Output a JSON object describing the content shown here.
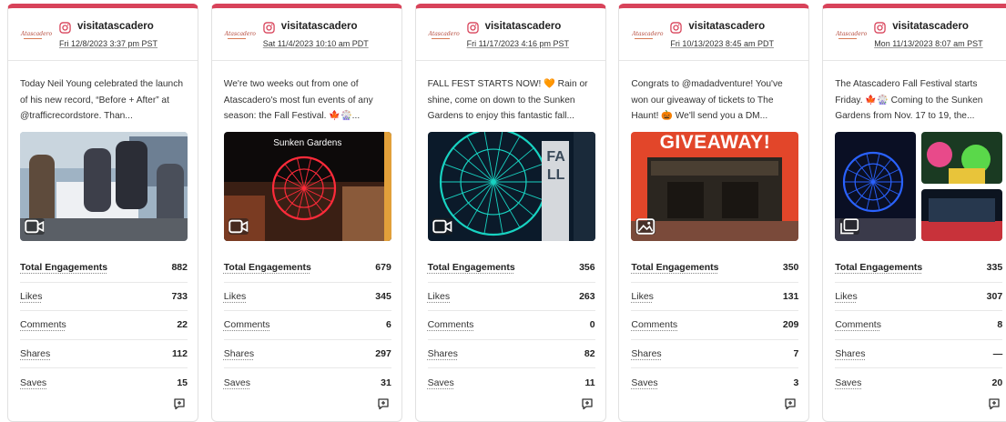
{
  "colors": {
    "accent": "#d8435a",
    "instagram": "#d8435a"
  },
  "icons": {
    "platform": "instagram-icon",
    "video": "video-icon",
    "image": "image-icon",
    "gallery": "gallery-icon",
    "comment": "add-comment-icon"
  },
  "metric_labels": [
    "Total Engagements",
    "Likes",
    "Comments",
    "Shares",
    "Saves"
  ],
  "posts": [
    {
      "logo": "Atascadero",
      "account": "visitatascadero",
      "date": "Fri 12/8/2023 3:37 pm PST",
      "caption": "Today Neil Young celebrated the launch of his new record, “Before + After” at @trafficrecordstore. Than...",
      "media_type": "video",
      "media_text": "",
      "metrics": [
        "882",
        "733",
        "22",
        "112",
        "15"
      ]
    },
    {
      "logo": "Atascadero",
      "account": "visitatascadero",
      "date": "Sat 11/4/2023 10:10 am PDT",
      "caption": "We're two weeks out from one of Atascadero's most fun events of any season: the Fall Festival. 🍁🎡...",
      "media_type": "video",
      "media_text": "Sunken Gardens",
      "metrics": [
        "679",
        "345",
        "6",
        "297",
        "31"
      ]
    },
    {
      "logo": "Atascadero",
      "account": "visitatascadero",
      "date": "Fri 11/17/2023 4:16 pm PST",
      "caption": "FALL FEST STARTS NOW! 🧡 Rain or shine, come on down to the Sunken Gardens to enjoy this fantastic fall...",
      "media_type": "video",
      "media_text": "FALL",
      "metrics": [
        "356",
        "263",
        "0",
        "82",
        "11"
      ]
    },
    {
      "logo": "Atascadero",
      "account": "visitatascadero",
      "date": "Fri 10/13/2023 8:45 am PDT",
      "caption": "Congrats to @madadventure! You've won our giveaway of tickets to The Haunt! 🎃 We'll send you a DM...",
      "media_type": "image",
      "media_text": "GIVEAWAY!",
      "metrics": [
        "350",
        "131",
        "209",
        "7",
        "3"
      ]
    },
    {
      "logo": "Atascadero",
      "account": "visitatascadero",
      "date": "Mon 11/13/2023 8:07 am PST",
      "caption": "The Atascadero Fall Festival starts Friday. 🍁🎡 Coming to the Sunken Gardens from Nov. 17 to 19, the...",
      "media_type": "gallery",
      "media_text": "",
      "metrics": [
        "335",
        "307",
        "8",
        "—",
        "20"
      ]
    }
  ]
}
